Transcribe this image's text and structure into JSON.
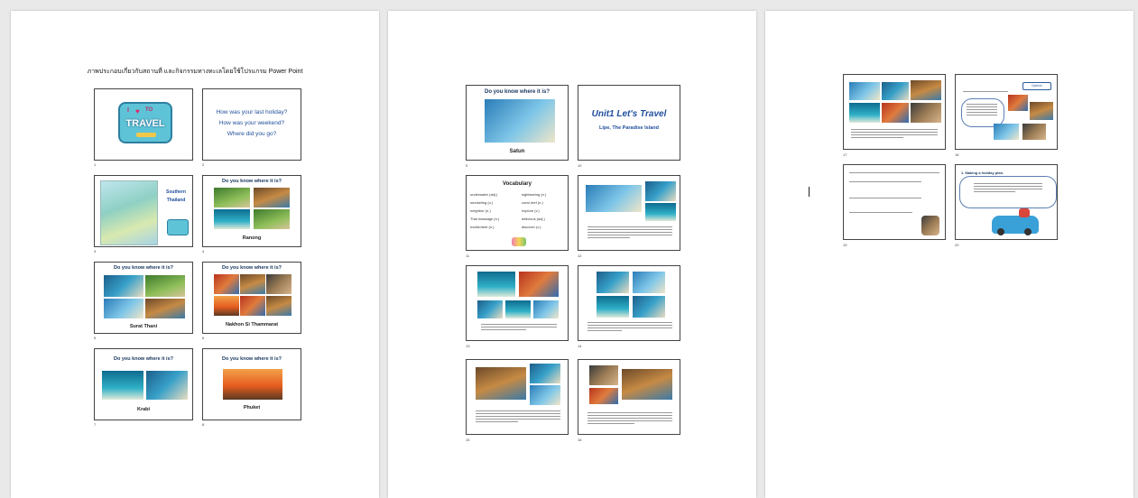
{
  "document": {
    "title": "ภาพประกอบเกี่ยวกับสถานที่ และกิจกรรมทางทะเลโดยใช้โปรแกรม Power Point"
  },
  "slides": {
    "s1": {
      "num": "1",
      "luggage_line1": "I",
      "luggage_line2": "TO",
      "luggage_word": "TRAVEL"
    },
    "s2": {
      "num": "2",
      "lines": [
        "How was your last holiday?",
        "How was your weekend?",
        "Where did you go?"
      ]
    },
    "s3": {
      "num": "3",
      "label": "Southern Thailand"
    },
    "s4": {
      "num": "4",
      "question": "Do you know where it is?",
      "place": "Ranong"
    },
    "s5": {
      "num": "5",
      "question": "Do you know where it is?",
      "place": "Surat Thani"
    },
    "s6": {
      "num": "6",
      "question": "Do you know where it is?",
      "place": "Nakhon Si Thammarat"
    },
    "s7": {
      "num": "7",
      "question": "Do you know where it is?",
      "place": "Krabi"
    },
    "s8": {
      "num": "8",
      "question": "Do you know where it is?",
      "place": "Phuket"
    },
    "s9": {
      "num": "9",
      "question": "Do you know where it is?",
      "place": "Satun"
    },
    "s10": {
      "num": "10",
      "title": "Unit1 Let's Travel",
      "subtitle": "Lipe, The Paradise Island"
    },
    "s11": {
      "num": "11",
      "title": "Vocabulary",
      "words": [
        "underwater (adj.)",
        "sightseeing (n.)",
        "snorkeling (n.)",
        "coral reef (n.)",
        "neighbor (n.)",
        "explore (v.)",
        "Thai massage (n.)",
        "delicious (adj.)",
        "excitement (n.)",
        "discover (v.)"
      ]
    },
    "s12": {
      "num": "12"
    },
    "s13": {
      "num": "13"
    },
    "s14": {
      "num": "14"
    },
    "s15": {
      "num": "15"
    },
    "s16": {
      "num": "16"
    },
    "s17": {
      "num": "17"
    },
    "s18": {
      "num": "18",
      "tag": "Opinion"
    },
    "s19": {
      "num": "19"
    },
    "s20": {
      "num": "20",
      "heading": "1. Making a holiday plan."
    }
  }
}
